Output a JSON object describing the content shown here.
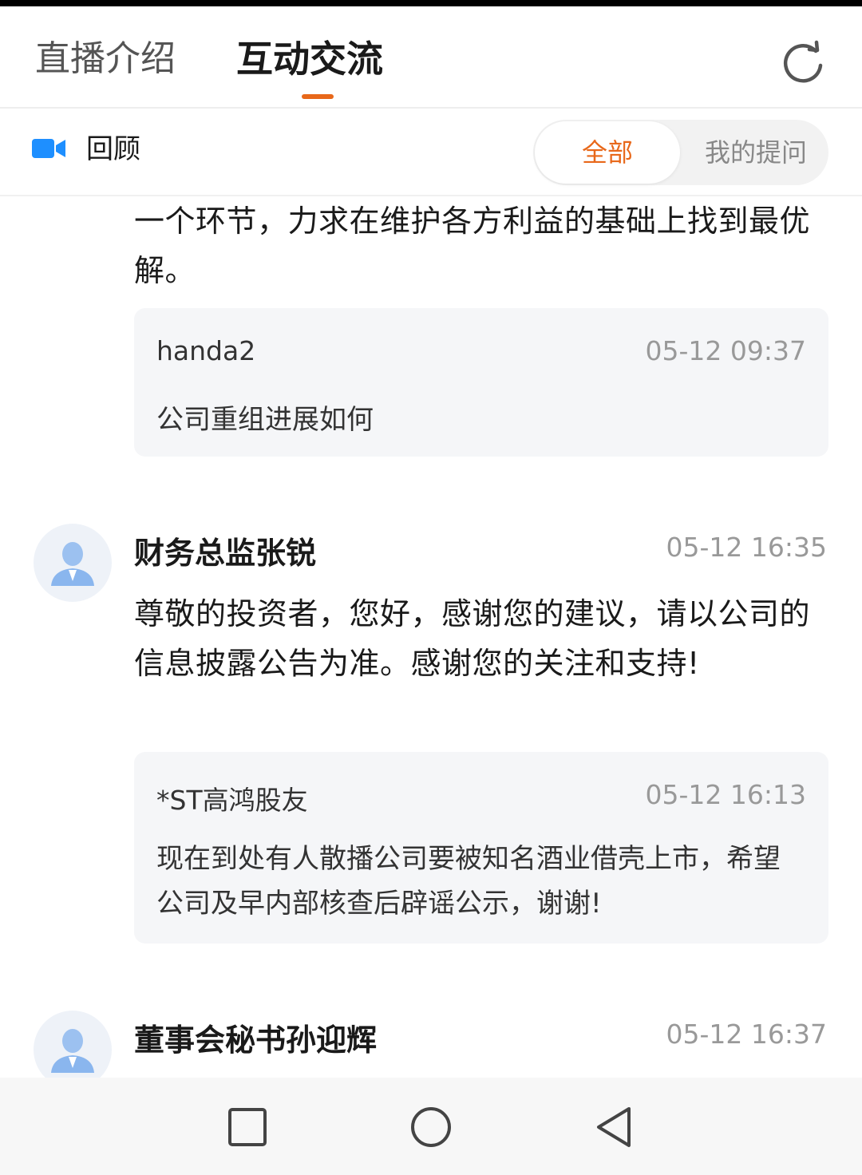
{
  "tabs": {
    "intro": "直播介绍",
    "interact": "互动交流"
  },
  "filter": {
    "review_label": "回顾",
    "all_label": "全部",
    "mine_label": "我的提问"
  },
  "feed": {
    "partial_answer": "一个环节，力求在维护各方利益的基础上找到最优解。",
    "partial_question": {
      "user": "handa2",
      "time": "05-12 09:37",
      "text": "公司重组进展如何"
    },
    "items": [
      {
        "author": "财务总监张锐",
        "time": "05-12 16:35",
        "answer": "尊敬的投资者，您好，感谢您的建议，请以公司的信息披露公告为准。感谢您的关注和支持!",
        "question": {
          "user": "*ST高鸿股友",
          "time": "05-12 16:13",
          "text": "现在到处有人散播公司要被知名酒业借壳上市，希望公司及早内部核查后辟谣公示，谢谢!"
        }
      },
      {
        "author": "董事会秘书孙迎辉",
        "time": "05-12 16:37"
      }
    ]
  },
  "colors": {
    "accent": "#e8681a",
    "review_icon": "#1e8fff"
  },
  "icons": {
    "refresh": "refresh-icon",
    "review": "video-camera-icon",
    "avatar": "user-avatar-icon",
    "nav_recents": "square-icon",
    "nav_home": "circle-icon",
    "nav_back": "triangle-back-icon"
  }
}
